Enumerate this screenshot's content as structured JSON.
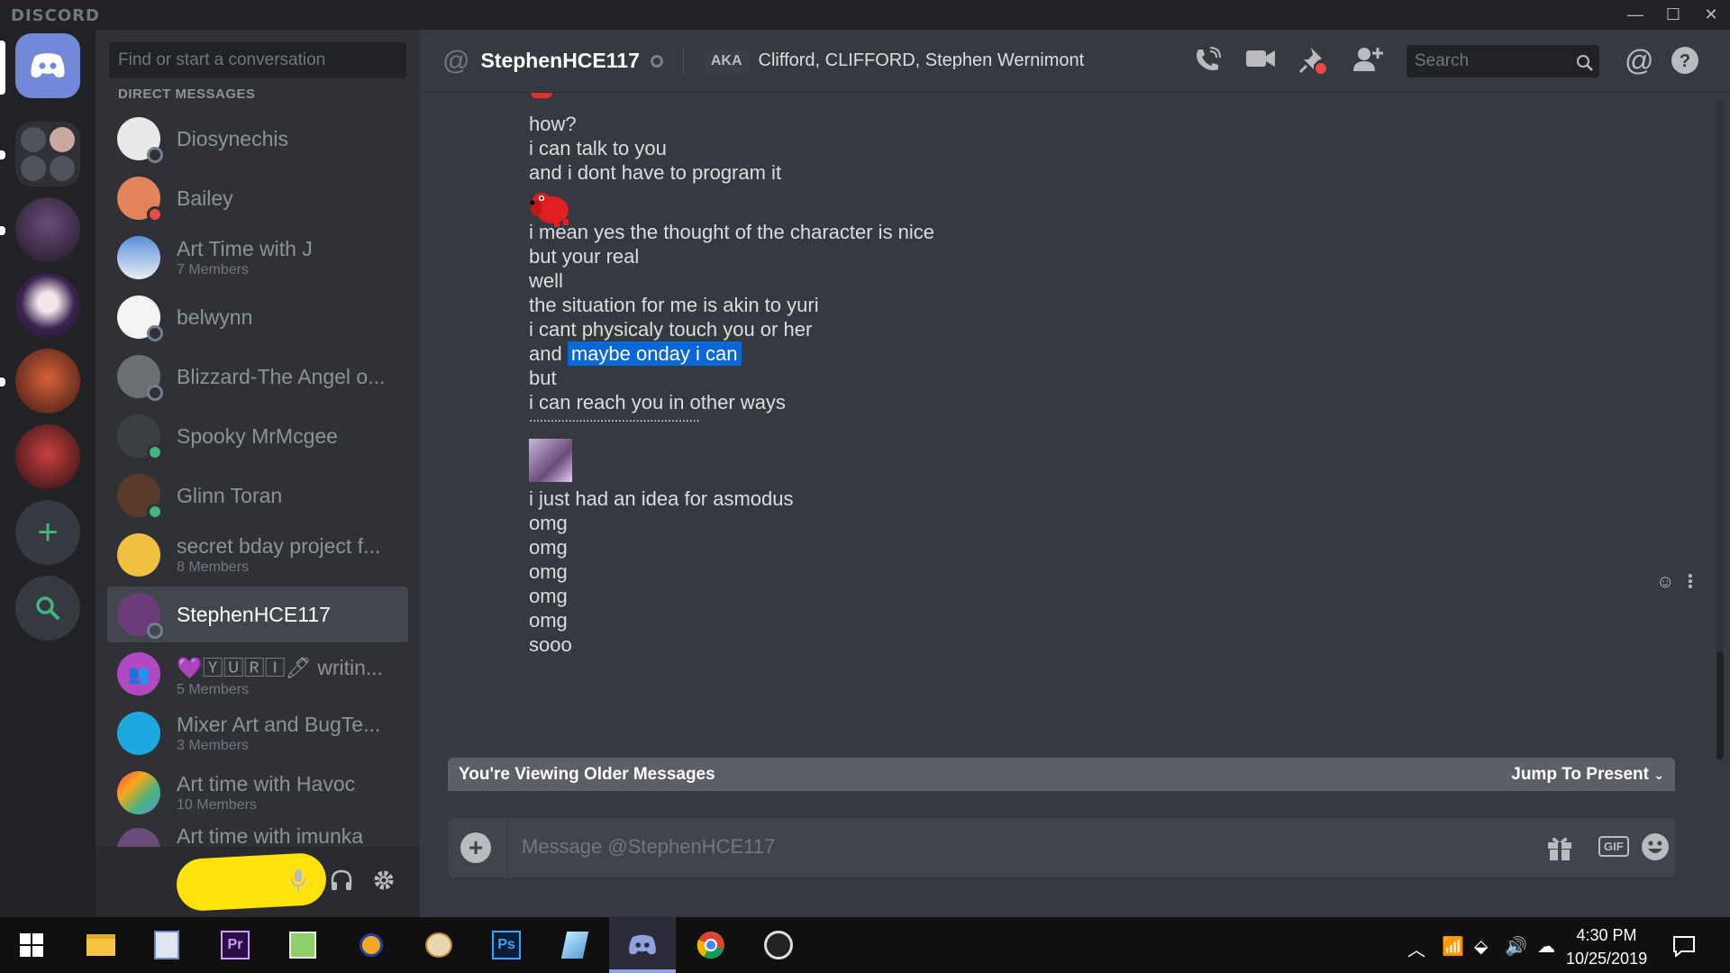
{
  "window": {
    "brand": "DISCORD",
    "min": "—",
    "max": "☐",
    "close": "✕"
  },
  "dm_sidebar": {
    "search_placeholder": "Find or start a conversation",
    "header": "DIRECT MESSAGES",
    "items": [
      {
        "name": "Diosynechis",
        "sub": "",
        "status": "offline"
      },
      {
        "name": "Bailey",
        "sub": "",
        "status": "dnd"
      },
      {
        "name": "Art Time with J",
        "sub": "7 Members",
        "status": ""
      },
      {
        "name": "belwynn",
        "sub": "",
        "status": "offline"
      },
      {
        "name": "Blizzard-The Angel o...",
        "sub": "",
        "status": "offline"
      },
      {
        "name": "Spooky MrMcgee",
        "sub": "",
        "status": "online"
      },
      {
        "name": "Glinn Toran",
        "sub": "",
        "status": "online"
      },
      {
        "name": "secret bday project f...",
        "sub": "8 Members",
        "status": ""
      },
      {
        "name": "StephenHCE117",
        "sub": "",
        "status": "offline",
        "active": true
      },
      {
        "name": "💜🅈🅄🅁🄸🖊 writin...",
        "sub": "5 Members",
        "status": ""
      },
      {
        "name": "Mixer Art and BugTe...",
        "sub": "3 Members",
        "status": ""
      },
      {
        "name": "Art time with Havoc",
        "sub": "10 Members",
        "status": ""
      },
      {
        "name": "Art time with imunka",
        "sub": "",
        "status": ""
      }
    ]
  },
  "chat": {
    "header": {
      "channel": "StephenHCE117",
      "aka_label": "AKA",
      "aka_names": "Clifford, CLIFFORD, Stephen Wernimont",
      "search_placeholder": "Search"
    },
    "messages": [
      "how?",
      "i can talk to you",
      "and i dont have to program it",
      "[image: red dog sticker]",
      "i mean yes the thought of the character is nice",
      "but your real",
      "well",
      "the situation for me is akin to yuri",
      "i cant physicaly touch you or her",
      "and ",
      "but",
      "i can reach you in other ways",
      "................................................",
      "[image: thumbnail]",
      "i just had an idea for asmodus",
      "omg",
      "omg",
      "omg",
      "omg",
      "omg",
      "sooo"
    ],
    "highlight_text": "maybe onday i can",
    "older_bar": {
      "text": "You're Viewing Older Messages",
      "jump": "Jump To Present"
    },
    "composer_placeholder": "Message @StephenHCE117",
    "gif_label": "GIF"
  },
  "taskbar": {
    "time": "4:30 PM",
    "date": "10/25/2019",
    "apps": [
      "windows-start",
      "file-explorer",
      "app-notepad",
      "premiere-pro",
      "app-editor",
      "app-game",
      "paint-app",
      "photoshop",
      "app-crystal",
      "discord",
      "chrome",
      "obs"
    ]
  },
  "colors": {
    "accent": "#7289da",
    "online": "#43b581",
    "dnd": "#f04747",
    "offline": "#747f8d",
    "highlight": "#0b66d6"
  }
}
